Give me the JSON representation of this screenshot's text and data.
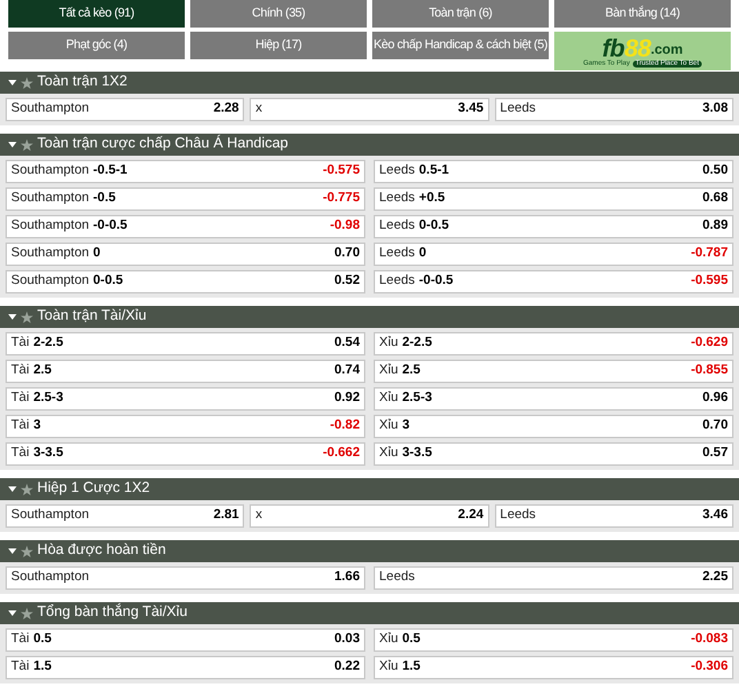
{
  "tabs": [
    {
      "label": "Tất cả kèo (91)",
      "selected": true
    },
    {
      "label": "Chính (35)",
      "selected": false
    },
    {
      "label": "Toàn trận (6)",
      "selected": false
    },
    {
      "label": "Bàn thắng (14)",
      "selected": false
    },
    {
      "label": "Phạt góc (4)",
      "selected": false
    },
    {
      "label": "Hiệp (17)",
      "selected": false
    },
    {
      "label": "Kèo chấp Handicap & cách biệt (5)",
      "selected": false
    }
  ],
  "logo": {
    "brand": "fb",
    "number": "88",
    "domain": ".com",
    "tagline": "Games To Play",
    "badge": "Trusted Place To Bet"
  },
  "sections": [
    {
      "title": "Toàn trận 1X2",
      "rows": [
        [
          {
            "name": "Southampton",
            "odds": "2.28",
            "negative": false
          },
          {
            "name": "x",
            "odds": "3.45",
            "negative": false
          },
          {
            "name": "Leeds",
            "odds": "3.08",
            "negative": false
          }
        ]
      ]
    },
    {
      "title": "Toàn trận cược chấp Châu Á Handicap",
      "rows": [
        [
          {
            "name": "Southampton",
            "line": "-0.5-1",
            "odds": "-0.575",
            "negative": true
          },
          {
            "name": "Leeds",
            "line": "0.5-1",
            "odds": "0.50",
            "negative": false
          }
        ],
        [
          {
            "name": "Southampton",
            "line": "-0.5",
            "odds": "-0.775",
            "negative": true
          },
          {
            "name": "Leeds",
            "line": "+0.5",
            "odds": "0.68",
            "negative": false
          }
        ],
        [
          {
            "name": "Southampton",
            "line": "-0-0.5",
            "odds": "-0.98",
            "negative": true
          },
          {
            "name": "Leeds",
            "line": "0-0.5",
            "odds": "0.89",
            "negative": false
          }
        ],
        [
          {
            "name": "Southampton",
            "line": "0",
            "odds": "0.70",
            "negative": false
          },
          {
            "name": "Leeds",
            "line": "0",
            "odds": "-0.787",
            "negative": true
          }
        ],
        [
          {
            "name": "Southampton",
            "line": "0-0.5",
            "odds": "0.52",
            "negative": false
          },
          {
            "name": "Leeds",
            "line": "-0-0.5",
            "odds": "-0.595",
            "negative": true
          }
        ]
      ]
    },
    {
      "title": "Toàn trận Tài/Xỉu",
      "rows": [
        [
          {
            "name": "Tài",
            "line": "2-2.5",
            "odds": "0.54",
            "negative": false
          },
          {
            "name": "Xỉu",
            "line": "2-2.5",
            "odds": "-0.629",
            "negative": true
          }
        ],
        [
          {
            "name": "Tài",
            "line": "2.5",
            "odds": "0.74",
            "negative": false
          },
          {
            "name": "Xỉu",
            "line": "2.5",
            "odds": "-0.855",
            "negative": true
          }
        ],
        [
          {
            "name": "Tài",
            "line": "2.5-3",
            "odds": "0.92",
            "negative": false
          },
          {
            "name": "Xỉu",
            "line": "2.5-3",
            "odds": "0.96",
            "negative": false
          }
        ],
        [
          {
            "name": "Tài",
            "line": "3",
            "odds": "-0.82",
            "negative": true
          },
          {
            "name": "Xỉu",
            "line": "3",
            "odds": "0.70",
            "negative": false
          }
        ],
        [
          {
            "name": "Tài",
            "line": "3-3.5",
            "odds": "-0.662",
            "negative": true
          },
          {
            "name": "Xỉu",
            "line": "3-3.5",
            "odds": "0.57",
            "negative": false
          }
        ]
      ]
    },
    {
      "title": "Hiệp 1 Cược 1X2",
      "rows": [
        [
          {
            "name": "Southampton",
            "odds": "2.81",
            "negative": false
          },
          {
            "name": "x",
            "odds": "2.24",
            "negative": false
          },
          {
            "name": "Leeds",
            "odds": "3.46",
            "negative": false
          }
        ]
      ]
    },
    {
      "title": "Hòa được hoàn tiền",
      "rows": [
        [
          {
            "name": "Southampton",
            "odds": "1.66",
            "negative": false
          },
          {
            "name": "Leeds",
            "odds": "2.25",
            "negative": false
          }
        ]
      ]
    },
    {
      "title": "Tổng bàn thắng Tài/Xỉu",
      "rows": [
        [
          {
            "name": "Tài",
            "line": "0.5",
            "odds": "0.03",
            "negative": false
          },
          {
            "name": "Xỉu",
            "line": "0.5",
            "odds": "-0.083",
            "negative": true
          }
        ],
        [
          {
            "name": "Tài",
            "line": "1.5",
            "odds": "0.22",
            "negative": false
          },
          {
            "name": "Xỉu",
            "line": "1.5",
            "odds": "-0.306",
            "negative": true
          }
        ]
      ]
    }
  ]
}
